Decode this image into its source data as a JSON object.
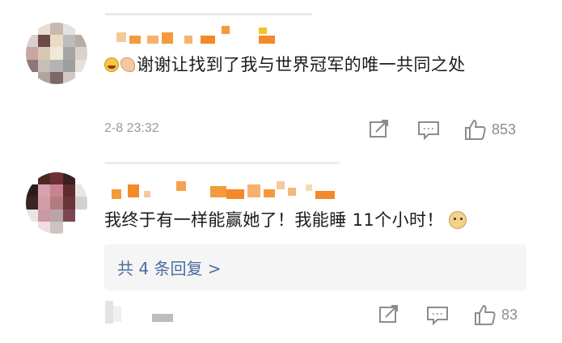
{
  "comments": [
    {
      "nickname_pixelated": true,
      "emojis": [
        "grinning-squinting-emoji",
        "clasped-hands-emoji"
      ],
      "text": "谢谢让找到了我与世界冠军的唯一共同之处",
      "time": "2-8 23:32",
      "likes": "853"
    },
    {
      "nickname_pixelated": true,
      "text": "我终于有一样能赢她了！我能睡 11个小时！",
      "trailing_emoji": "doge-emoji",
      "reply_summary": "共 4 条回复 >",
      "time_pixelated": true,
      "likes": "83"
    }
  ],
  "icons": {
    "repost": "repost-icon",
    "comment": "comment-icon",
    "like": "like-thumb-icon"
  },
  "colors": {
    "link": "#4a6d9e",
    "meta": "#9a9a9a",
    "nickname_orange": "#f39a3c"
  }
}
